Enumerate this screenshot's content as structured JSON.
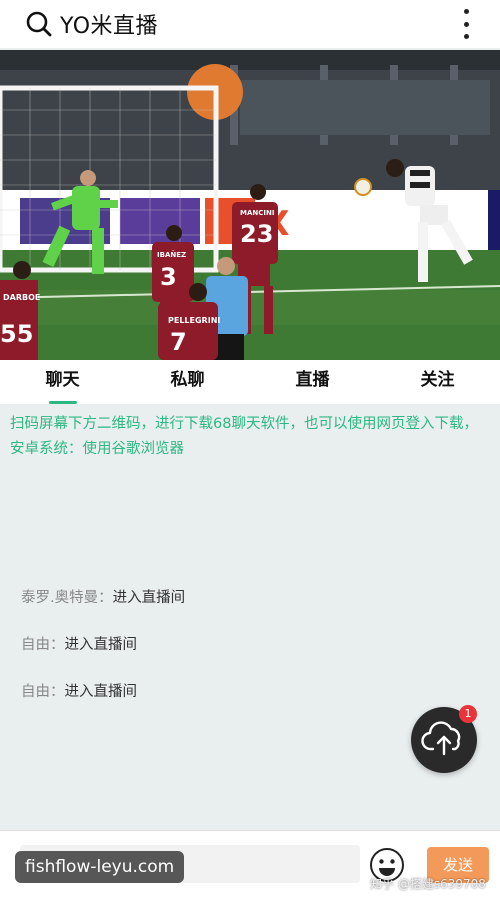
{
  "app": {
    "title": "YO米直播"
  },
  "tabs": [
    "聊天",
    "私聊",
    "直播",
    "关注"
  ],
  "notice": "扫码屏幕下方二维码，进行下载68聊天软件，也可以使用网页登入下载，安卓系统：使用谷歌浏览器",
  "messages": [
    {
      "user": "泰罗.奥特曼",
      "sep": "：",
      "text": "进入直播间"
    },
    {
      "user": "自由",
      "sep": "：",
      "text": "进入直播间"
    },
    {
      "user": "自由",
      "sep": "：",
      "text": "进入直播间"
    }
  ],
  "badge_count": "1",
  "footer": {
    "send_label": "发送",
    "watermark_left": "fishflow-leyu.com",
    "watermark_right": "知乎 @搭建s639708"
  },
  "hero": {
    "jerseys": [
      "55",
      "3",
      "23",
      "7"
    ],
    "names": [
      "DARBOE",
      "IBAÑEZ",
      "MANCINI",
      "PELLEGRINI"
    ]
  },
  "colors": {
    "accent": "#2db883",
    "send": "#f39a5a",
    "badge": "#e9343a"
  }
}
